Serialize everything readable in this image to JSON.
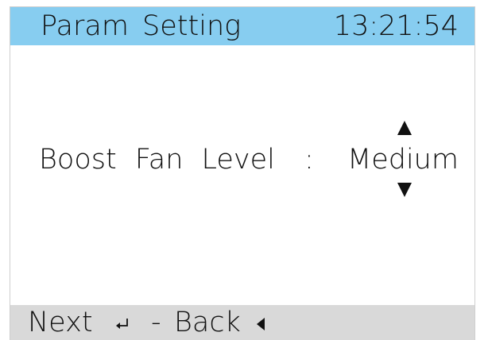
{
  "header": {
    "title": "Param Setting",
    "time": "13:21:54",
    "background_color": "#87cdf0"
  },
  "parameter": {
    "label": "Boost Fan Level",
    "separator": ":",
    "value": "Medium",
    "increase_icon": "triangle-up-icon",
    "decrease_icon": "triangle-down-icon"
  },
  "footer": {
    "next_label": "Next",
    "next_icon": "enter-icon",
    "separator": "-",
    "back_label": "Back",
    "back_icon": "triangle-left-icon",
    "background_color": "#d9d9d9"
  }
}
